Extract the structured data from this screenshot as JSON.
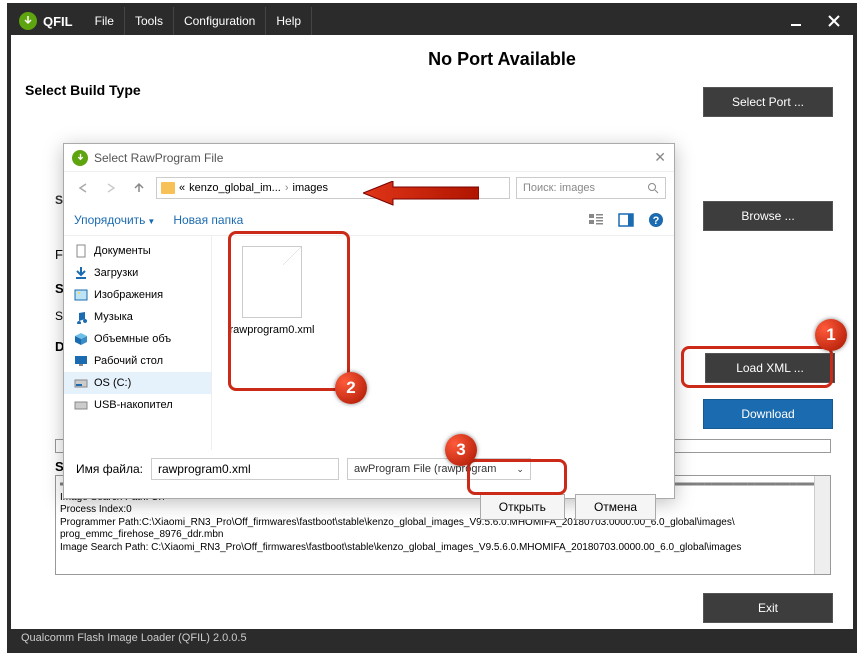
{
  "app": {
    "title": "QFIL",
    "menu": [
      "File",
      "Tools",
      "Configuration",
      "Help"
    ],
    "status": "Qualcomm Flash Image Loader (QFIL)   2.0.0.5"
  },
  "header": {
    "no_port": "No Port Available",
    "select_port": "Select Port ..."
  },
  "labels": {
    "build_type": "Select Build Type",
    "browse": "Browse ...",
    "load_xml": "Load XML ...",
    "download": "Download",
    "exit": "Exit",
    "s_prefix": "S",
    "d_prefix": "D",
    "status_s": "S",
    "side_s2": "S",
    "side_s3": "S",
    "side_f": "F"
  },
  "log": {
    "l1": "Image Search Path: C:\\",
    "l2": "Process Index:0",
    "l3": "Programmer Path:C:\\Xiaomi_RN3_Pro\\Off_firmwares\\fastboot\\stable\\kenzo_global_images_V9.5.6.0.MHOMIFA_20180703.0000.00_6.0_global\\images\\",
    "l4": "prog_emmc_firehose_8976_ddr.mbn",
    "l5": "Image Search Path: C:\\Xiaomi_RN3_Pro\\Off_firmwares\\fastboot\\stable\\kenzo_global_images_V9.5.6.0.MHOMIFA_20180703.0000.00_6.0_global\\images"
  },
  "dialog": {
    "title": "Select RawProgram File",
    "path_parent": "kenzo_global_im...",
    "path_current": "images",
    "search_placeholder": "Поиск: images",
    "organize": "Упорядочить",
    "new_folder": "Новая папка",
    "sidebar": [
      {
        "icon": "doc",
        "label": "Документы"
      },
      {
        "icon": "down",
        "label": "Загрузки"
      },
      {
        "icon": "pic",
        "label": "Изображения"
      },
      {
        "icon": "music",
        "label": "Музыка"
      },
      {
        "icon": "obj",
        "label": "Объемные объ"
      },
      {
        "icon": "desk",
        "label": "Рабочий стол"
      },
      {
        "icon": "disk",
        "label": "OS (C:)"
      },
      {
        "icon": "usb",
        "label": "USB-накопител"
      }
    ],
    "file": "rawprogram0.xml",
    "filename_label": "Имя файла:",
    "filename_value": "rawprogram0.xml",
    "filetype": "awProgram File (rawprogram",
    "open": "Открыть",
    "cancel": "Отмена"
  },
  "anno": {
    "b1": "1",
    "b2": "2",
    "b3": "3"
  }
}
